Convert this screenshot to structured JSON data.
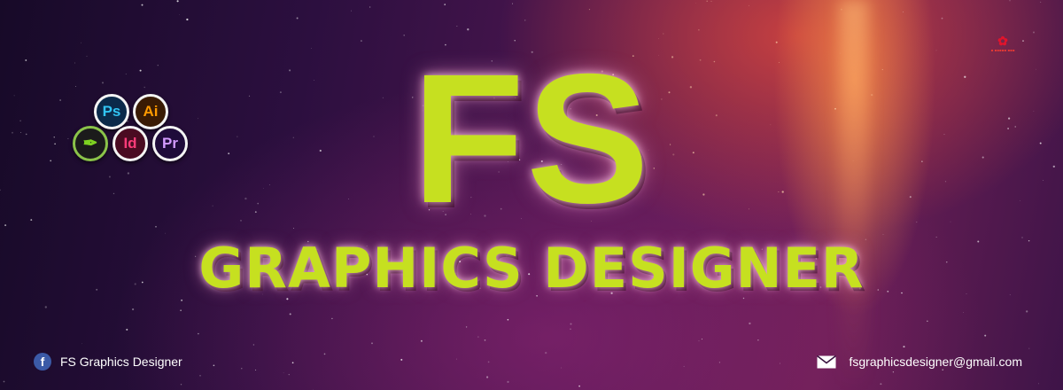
{
  "brand": {
    "title": "FS",
    "subtitle": "GRAPHICS DESIGNER",
    "accent_color": "#c6e020"
  },
  "app_icons": [
    {
      "label": "Ps",
      "name": "photoshop-icon"
    },
    {
      "label": "Ai",
      "name": "illustrator-icon"
    },
    {
      "label": "",
      "name": "coreldraw-icon"
    },
    {
      "label": "Id",
      "name": "indesign-icon"
    },
    {
      "label": "Pr",
      "name": "premiere-icon"
    }
  ],
  "corner_logo": {
    "icon": "watermark-logo-icon"
  },
  "footer": {
    "facebook": {
      "icon": "facebook-icon",
      "glyph": "f",
      "label": "FS Graphics Designer"
    },
    "email": {
      "icon": "mail-icon",
      "label": "fsgraphicsdesigner@gmail.com"
    }
  }
}
